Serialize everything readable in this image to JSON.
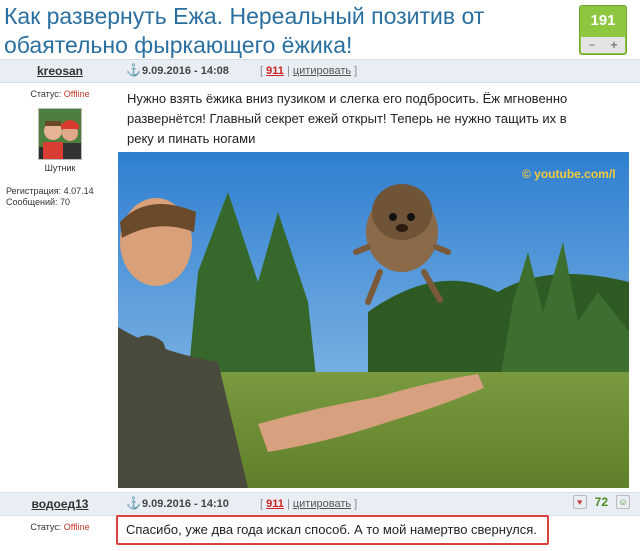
{
  "title": "Как развернуть Ежа. Нереальный позитив от обаятельно фыркающего ёжика!",
  "rating": {
    "count": "191",
    "minus": "−",
    "plus": "+",
    "accent": "#8dc63f"
  },
  "post": {
    "username": "kreosan",
    "anchor_icon": "anchor-icon",
    "anchor_glyph": "⚓",
    "date": "9.09.2016 - 14:08",
    "bracket_open": "[",
    "rating_value": "911",
    "separator": "|",
    "quote_label": "цитировать",
    "bracket_close": "]",
    "status_label": "Статус:",
    "status_value": "Offline",
    "rank": "Шутник",
    "registration": "Регистрация: 4.07.14",
    "messages": "Сообщений: 70",
    "text": "Нужно взять ёжика вниз пузиком и слегка его подбросить. Ёж мгновенно развернётся! Главный секрет ежей открыт! Теперь не нужно тащить их в реку и пинать ногами",
    "image_watermark": "© youtube.com/l"
  },
  "reply": {
    "username": "водоед13",
    "anchor_glyph": "⚓",
    "date": "9.09.2016 - 14:10",
    "bracket_open": "[",
    "rating_value": "911",
    "separator": "|",
    "quote_label": "цитировать",
    "bracket_close": "]",
    "status_label": "Статус:",
    "status_value": "Offline",
    "score": "72",
    "minus_icon_glyph": "♥",
    "plus_icon_glyph": "☺",
    "text": "Спасибо, уже два года искал способ. А то мой намертво свернулся.",
    "highlight_color": "#d9433f"
  }
}
